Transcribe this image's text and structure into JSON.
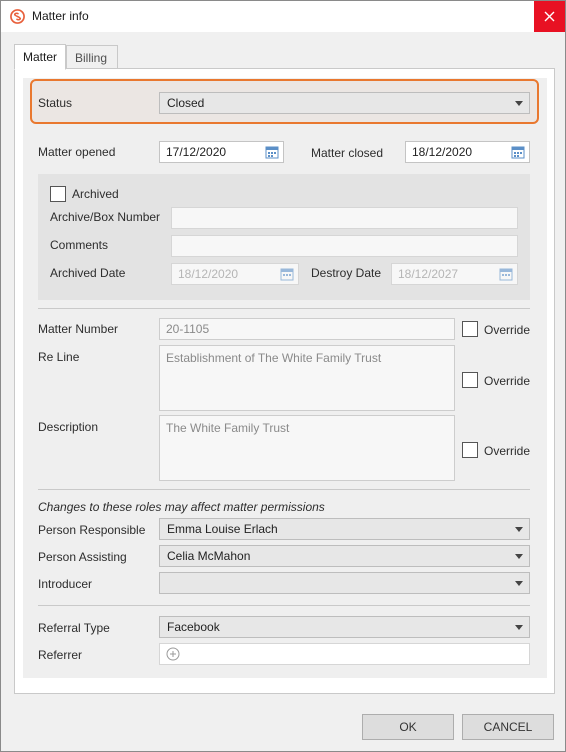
{
  "window": {
    "title": "Matter info"
  },
  "tabs": [
    {
      "label": "Matter"
    },
    {
      "label": "Billing"
    }
  ],
  "status": {
    "label": "Status",
    "value": "Closed"
  },
  "dates": {
    "opened_label": "Matter opened",
    "opened_value": "17/12/2020",
    "closed_label": "Matter closed",
    "closed_value": "18/12/2020"
  },
  "archive": {
    "archived_label": "Archived",
    "box_label": "Archive/Box Number",
    "box_value": "",
    "comments_label": "Comments",
    "comments_value": "",
    "archived_date_label": "Archived Date",
    "archived_date_value": "18/12/2020",
    "destroy_date_label": "Destroy Date",
    "destroy_date_value": "18/12/2027"
  },
  "details": {
    "number_label": "Matter Number",
    "number_value": "20-1105",
    "reline_label": "Re Line",
    "reline_value": "Establishment of The White Family Trust",
    "description_label": "Description",
    "description_value": "The White Family Trust",
    "override_label": "Override"
  },
  "roles": {
    "note": "Changes to these roles may affect matter permissions",
    "responsible_label": "Person Responsible",
    "responsible_value": "Emma Louise Erlach",
    "assisting_label": "Person Assisting",
    "assisting_value": "Celia McMahon",
    "introducer_label": "Introducer",
    "introducer_value": ""
  },
  "referral": {
    "type_label": "Referral Type",
    "type_value": "Facebook",
    "referrer_label": "Referrer"
  },
  "buttons": {
    "ok": "OK",
    "cancel": "CANCEL"
  },
  "colors": {
    "close_bg": "#e81123",
    "highlight": "#e9782f",
    "brand": "#e8603c"
  }
}
